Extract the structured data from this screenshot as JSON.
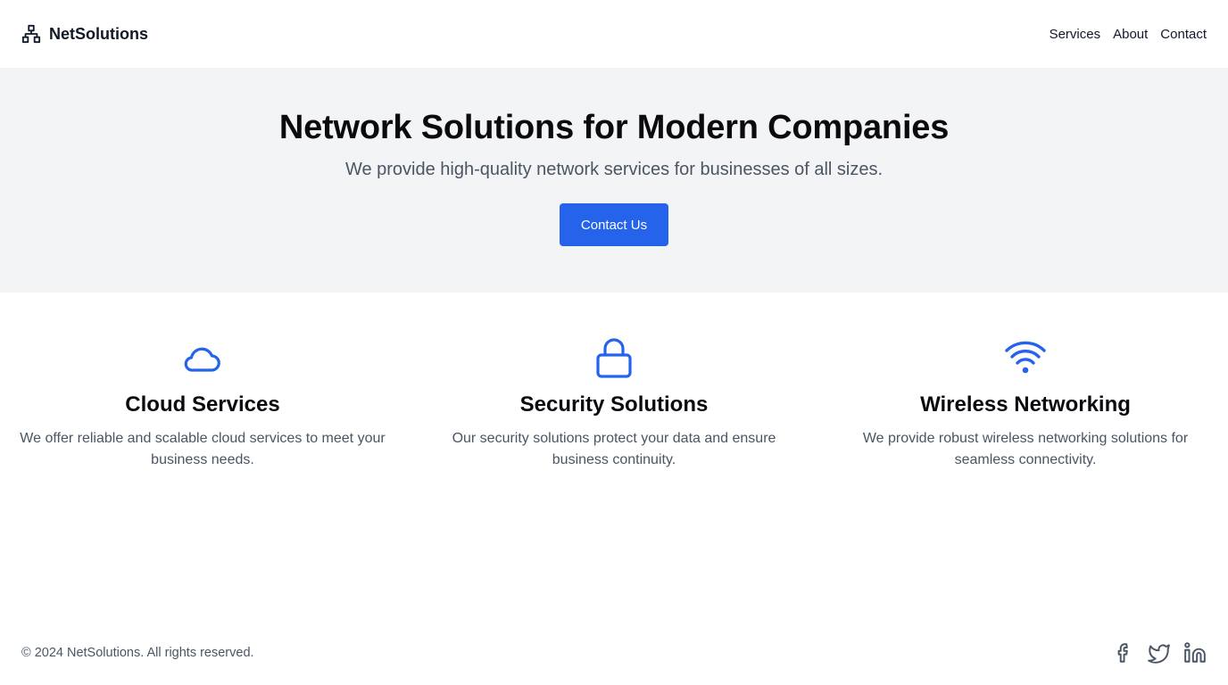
{
  "brand": {
    "name": "NetSolutions",
    "icon": "network-icon"
  },
  "nav": {
    "items": [
      {
        "label": "Services"
      },
      {
        "label": "About"
      },
      {
        "label": "Contact"
      }
    ]
  },
  "hero": {
    "title": "Network Solutions for Modern Companies",
    "subtitle": "We provide high-quality network services for businesses of all sizes.",
    "button_label": "Contact Us"
  },
  "features": [
    {
      "icon": "cloud-icon",
      "title": "Cloud Services",
      "text": "We offer reliable and scalable cloud services to meet your business needs."
    },
    {
      "icon": "lock-icon",
      "title": "Security Solutions",
      "text": "Our security solutions protect your data and ensure business continuity."
    },
    {
      "icon": "wifi-icon",
      "title": "Wireless Networking",
      "text": "We provide robust wireless networking solutions for seamless connectivity."
    }
  ],
  "footer": {
    "copyright": "© 2024 NetSolutions. All rights reserved.",
    "socials": [
      "facebook-icon",
      "twitter-icon",
      "linkedin-icon"
    ]
  },
  "colors": {
    "accent": "#2563eb",
    "hero_background": "#f3f4f6",
    "muted_text": "#4b5563",
    "heading_text": "#0b0b0f"
  }
}
